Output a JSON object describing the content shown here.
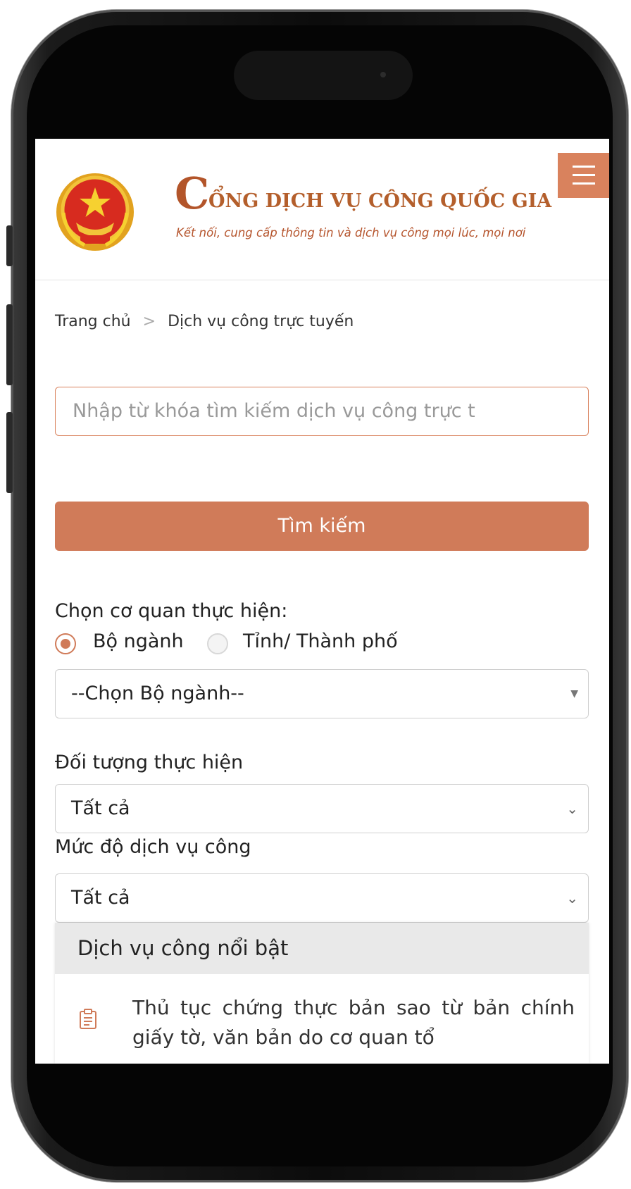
{
  "header": {
    "title_initial": "C",
    "title_rest": "ỔNG DỊCH VỤ CÔNG QUỐC GIA",
    "subtitle": "Kết nối, cung cấp thông tin và dịch vụ công mọi lúc, mọi nơi",
    "menu_icon": "hamburger-menu-icon",
    "emblem_icon": "national-emblem-icon",
    "accent_color": "#d07b59"
  },
  "breadcrumb": {
    "home": "Trang chủ",
    "separator": ">",
    "current": "Dịch vụ công trực tuyến"
  },
  "search": {
    "placeholder": "Nhập từ khóa tìm kiếm dịch vụ công trực t",
    "button_label": "Tìm kiếm"
  },
  "filters": {
    "agency_label": "Chọn cơ quan thực hiện:",
    "agency_options": [
      {
        "label": "Bộ ngành",
        "selected": true
      },
      {
        "label": "Tỉnh/ Thành phố",
        "selected": false
      }
    ],
    "agency_select_value": "--Chọn Bộ ngành--",
    "subject_label": "Đối tượng thực hiện",
    "subject_value": "Tất cả",
    "level_label": "Mức độ dịch vụ công",
    "level_value": "Tất cả"
  },
  "featured": {
    "heading": "Dịch vụ công nổi bật",
    "items": [
      {
        "icon": "document-clipboard-icon",
        "text": "Thủ tục chứng thực bản sao từ bản chính giấy tờ, văn bản do cơ quan tổ"
      }
    ]
  }
}
